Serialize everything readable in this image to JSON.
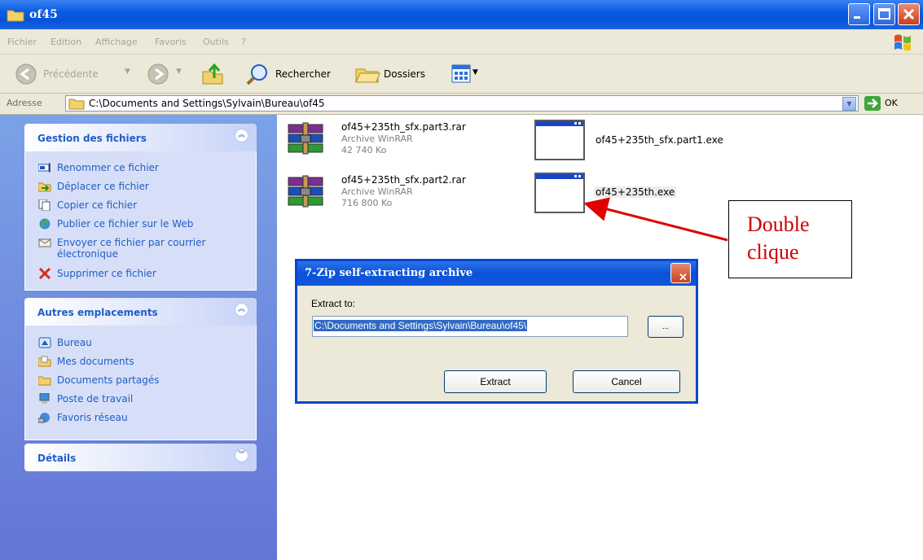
{
  "window": {
    "title": "of45"
  },
  "menu": [
    "Fichier",
    "Edition",
    "Affichage",
    "Favoris",
    "Outils",
    "?"
  ],
  "toolbar": {
    "back_label": "Précédente",
    "search_label": "Rechercher",
    "folders_label": "Dossiers"
  },
  "address": {
    "label": "Adresse",
    "path": "C:\\Documents and Settings\\Sylvain\\Bureau\\of45",
    "go_label": "OK"
  },
  "tasks": {
    "title": "Gestion des fichiers",
    "items": [
      {
        "label": "Renommer ce fichier",
        "icon": "rename-icon"
      },
      {
        "label": "Déplacer ce fichier",
        "icon": "move-icon"
      },
      {
        "label": "Copier ce fichier",
        "icon": "copy-icon"
      },
      {
        "label": "Publier ce fichier sur le Web",
        "icon": "globe-icon"
      },
      {
        "label": "Envoyer ce fichier par courrier",
        "label2": "électronique",
        "icon": "mail-icon"
      },
      {
        "label": "Supprimer ce fichier",
        "icon": "delete-icon"
      }
    ]
  },
  "places": {
    "title": "Autres emplacements",
    "items": [
      {
        "label": "Bureau",
        "icon": "desktop-icon"
      },
      {
        "label": "Mes documents",
        "icon": "documents-folder-icon"
      },
      {
        "label": "Documents partagés",
        "icon": "shared-folder-icon"
      },
      {
        "label": "Poste de travail",
        "icon": "computer-icon"
      },
      {
        "label": "Favoris réseau",
        "icon": "network-icon"
      }
    ]
  },
  "details": {
    "title": "Détails"
  },
  "files": [
    {
      "name": "of45+235th_sfx.part3.rar",
      "type": "Archive WinRAR",
      "size": "42 740 Ko",
      "icon": "winrar-archive-icon"
    },
    {
      "name": "of45+235th_sfx.part2.rar",
      "type": "Archive WinRAR",
      "size": "716 800 Ko",
      "icon": "winrar-archive-icon"
    },
    {
      "name": "of45+235th_sfx.part1.exe",
      "icon": "exe-window-icon"
    },
    {
      "name": "of45+235th.exe",
      "icon": "exe-window-icon"
    }
  ],
  "annotation": {
    "line1": "Double",
    "line2": "clique",
    "color": "#d00000"
  },
  "dialog": {
    "title": "7-Zip self-extracting archive",
    "extract_label": "Extract to:",
    "path_value": "C:\\Documents and Settings\\Sylvain\\Bureau\\of45\\",
    "browse_label": "...",
    "extract_button": "Extract",
    "cancel_button": "Cancel"
  },
  "colors": {
    "titlebar": "#0453d8",
    "pane_gradient_top": "#7ba2e7",
    "task_link": "#215dc6"
  }
}
